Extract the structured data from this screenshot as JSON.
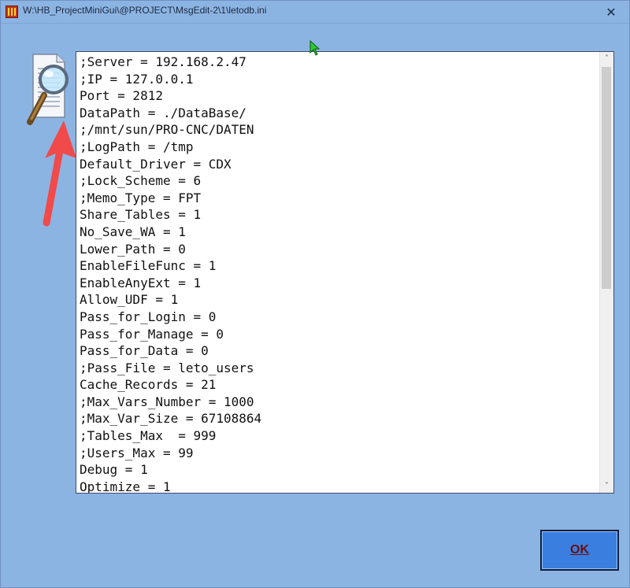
{
  "window": {
    "title": "W:\\HB_ProjectMiniGui\\@PROJECT\\MsgEdit-2\\1\\letodb.ini",
    "close_glyph": "✕"
  },
  "editor": {
    "lines": [
      ";Server = 192.168.2.47",
      ";IP = 127.0.0.1",
      "Port = 2812",
      "DataPath = ./DataBase/",
      ";/mnt/sun/PRO-CNC/DATEN",
      ";LogPath = /tmp",
      "Default_Driver = CDX",
      ";Lock_Scheme = 6",
      ";Memo_Type = FPT",
      "Share_Tables = 1",
      "No_Save_WA = 1",
      "Lower_Path = 0",
      "EnableFileFunc = 1",
      "EnableAnyExt = 1",
      "Allow_UDF = 1",
      "Pass_for_Login = 0",
      "Pass_for_Manage = 0",
      "Pass_for_Data = 0",
      ";Pass_File = leto_users",
      "Cache_Records = 21",
      ";Max_Vars_Number = 1000",
      ";Max_Var_Size = 67108864",
      ";Tables_Max  = 999",
      ";Users_Max = 99",
      "Debug = 1",
      "Optimize = 1"
    ]
  },
  "scroll": {
    "up_glyph": "˄",
    "down_glyph": "˅"
  },
  "buttons": {
    "ok_label": "OK"
  },
  "icons": {
    "app": "app-icon",
    "document": "document-magnifier-icon",
    "annotation": "red-arrow-icon",
    "cursor": "mouse-cursor-icon"
  },
  "colors": {
    "background": "#8cb4e3",
    "ok_button": "#3a7fe0",
    "arrow": "#f04a4a"
  }
}
